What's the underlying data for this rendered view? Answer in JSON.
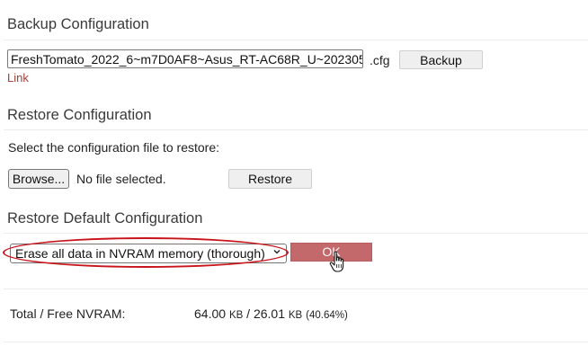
{
  "backup": {
    "title": "Backup Configuration",
    "filename": "FreshTomato_2022_6~m7D0AF8~Asus_RT-AC68R_U~202305",
    "extension": ".cfg",
    "button": "Backup",
    "link": "Link"
  },
  "restore": {
    "title": "Restore Configuration",
    "instruction": "Select the configuration file to restore:",
    "browse_button": "Browse...",
    "file_status": "No file selected.",
    "button": "Restore"
  },
  "restore_default": {
    "title": "Restore Default Configuration",
    "select_value": "Erase all data in NVRAM memory (thorough)",
    "ok_button": "OK",
    "highlight_color": "#c9141b"
  },
  "nvram": {
    "label": "Total / Free NVRAM:",
    "total": "64.00",
    "total_unit": "KB",
    "separator": "/",
    "free": "26.01",
    "free_unit": "KB",
    "free_pct": "(40.64%)"
  },
  "colors": {
    "link": "#a0413b",
    "ok_button_bg": "#c3696b"
  }
}
